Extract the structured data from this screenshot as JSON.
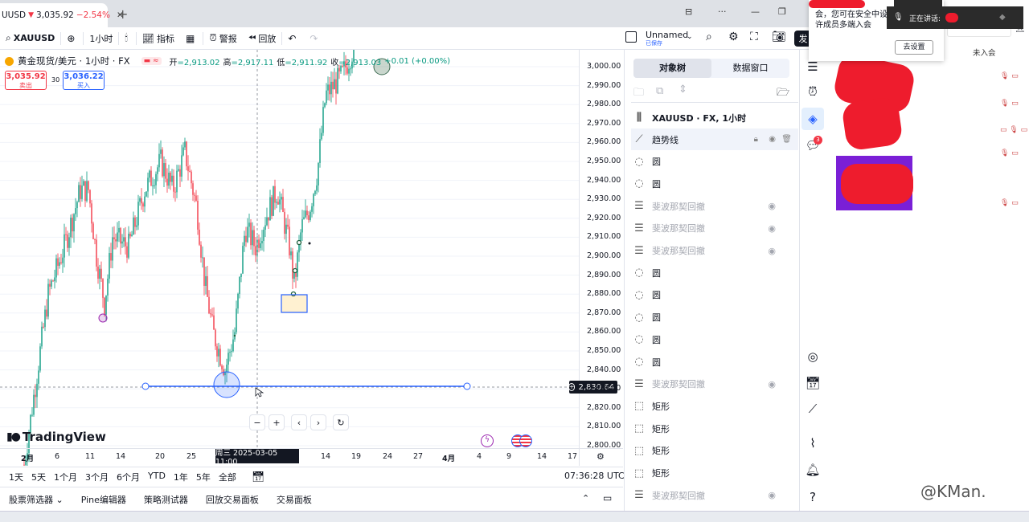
{
  "tab": {
    "symbol": "UUSD",
    "arrow": "▼",
    "price": "3,035.92",
    "change": "−2.54%",
    "close": "✕"
  },
  "toolbar": {
    "search_symbol": "XAUUSD",
    "interval": "1小时",
    "indicators": "指标",
    "alert": "警报",
    "replay": "回放",
    "layout_name": "Unnamed",
    "layout_sub": "已保存",
    "publish": "发"
  },
  "legend": {
    "title": "黄金现货/美元 · 1小时 · FX",
    "open_label": "开",
    "open": "2,913.02",
    "high_label": "高",
    "high": "2,917.11",
    "low_label": "低",
    "low": "2,911.92",
    "close_label": "收",
    "close": "2,913.03",
    "change": "+0.01 (+0.00%)"
  },
  "quote": {
    "sell_price": "3,035.92",
    "sell_label": "卖出",
    "spread": "30",
    "buy_price": "3,036.22",
    "buy_label": "买入"
  },
  "brand": "TradingView",
  "price_axis": [
    "3,000.00",
    "2,990.00",
    "2,980.00",
    "2,970.00",
    "2,960.00",
    "2,950.00",
    "2,940.00",
    "2,930.00",
    "2,920.00",
    "2,910.00",
    "2,900.00",
    "2,890.00",
    "2,880.00",
    "2,870.00",
    "2,860.00",
    "2,850.00",
    "2,840.00",
    "2,830.00",
    "2,820.00",
    "2,810.00",
    "2,800.00"
  ],
  "price_highlight": "2,830.64",
  "time_axis": [
    "2月",
    "6",
    "11",
    "14",
    "20",
    "25",
    "14",
    "19",
    "24",
    "27",
    "4月",
    "4",
    "9",
    "14",
    "17"
  ],
  "time_highlight": "周三 2025-03-05   11:00",
  "ranges": [
    "1天",
    "5天",
    "1个月",
    "3个月",
    "6个月",
    "YTD",
    "1年",
    "5年",
    "全部"
  ],
  "clock": "07:36:28 UTC",
  "bottom_tabs": [
    "股票筛选器",
    "Pine编辑器",
    "策略测试器",
    "回放交易面板",
    "交易面板"
  ],
  "object_tree": {
    "tab_tree": "对象树",
    "tab_data": "数据窗口",
    "symbol_row": "XAUUSD · FX, 1小时",
    "items": [
      {
        "label": "趋势线",
        "icon": "trendline-icon",
        "hidden": false,
        "selected": true
      },
      {
        "label": "圆",
        "icon": "circle-icon",
        "hidden": false
      },
      {
        "label": "圆",
        "icon": "circle-icon",
        "hidden": false
      },
      {
        "label": "斐波那契回撤",
        "icon": "fib-icon",
        "hidden": true
      },
      {
        "label": "斐波那契回撤",
        "icon": "fib-icon",
        "hidden": true
      },
      {
        "label": "斐波那契回撤",
        "icon": "fib-icon",
        "hidden": true
      },
      {
        "label": "圆",
        "icon": "circle-icon",
        "hidden": false
      },
      {
        "label": "圆",
        "icon": "circle-icon",
        "hidden": false
      },
      {
        "label": "圆",
        "icon": "circle-icon",
        "hidden": false
      },
      {
        "label": "圆",
        "icon": "circle-icon",
        "hidden": false
      },
      {
        "label": "圆",
        "icon": "circle-icon",
        "hidden": false
      },
      {
        "label": "斐波那契回撤",
        "icon": "fib-icon",
        "hidden": true
      },
      {
        "label": "矩形",
        "icon": "rectangle-icon",
        "hidden": false
      },
      {
        "label": "矩形",
        "icon": "rectangle-icon",
        "hidden": false
      },
      {
        "label": "矩形",
        "icon": "rectangle-icon",
        "hidden": false
      },
      {
        "label": "矩形",
        "icon": "rectangle-icon",
        "hidden": false
      },
      {
        "label": "斐波那契回撤",
        "icon": "fib-icon",
        "hidden": true
      }
    ]
  },
  "sidebar_badge": "3",
  "meeting": {
    "popup_text": "会，您可在安全中设许成员多端入会",
    "popup_button": "去设置",
    "talking": "正在讲话:",
    "not_joined": "未入会"
  },
  "watermark": "@KMan.",
  "colors": {
    "up": "#089981",
    "down": "#f23645",
    "accent": "#2962ff"
  }
}
